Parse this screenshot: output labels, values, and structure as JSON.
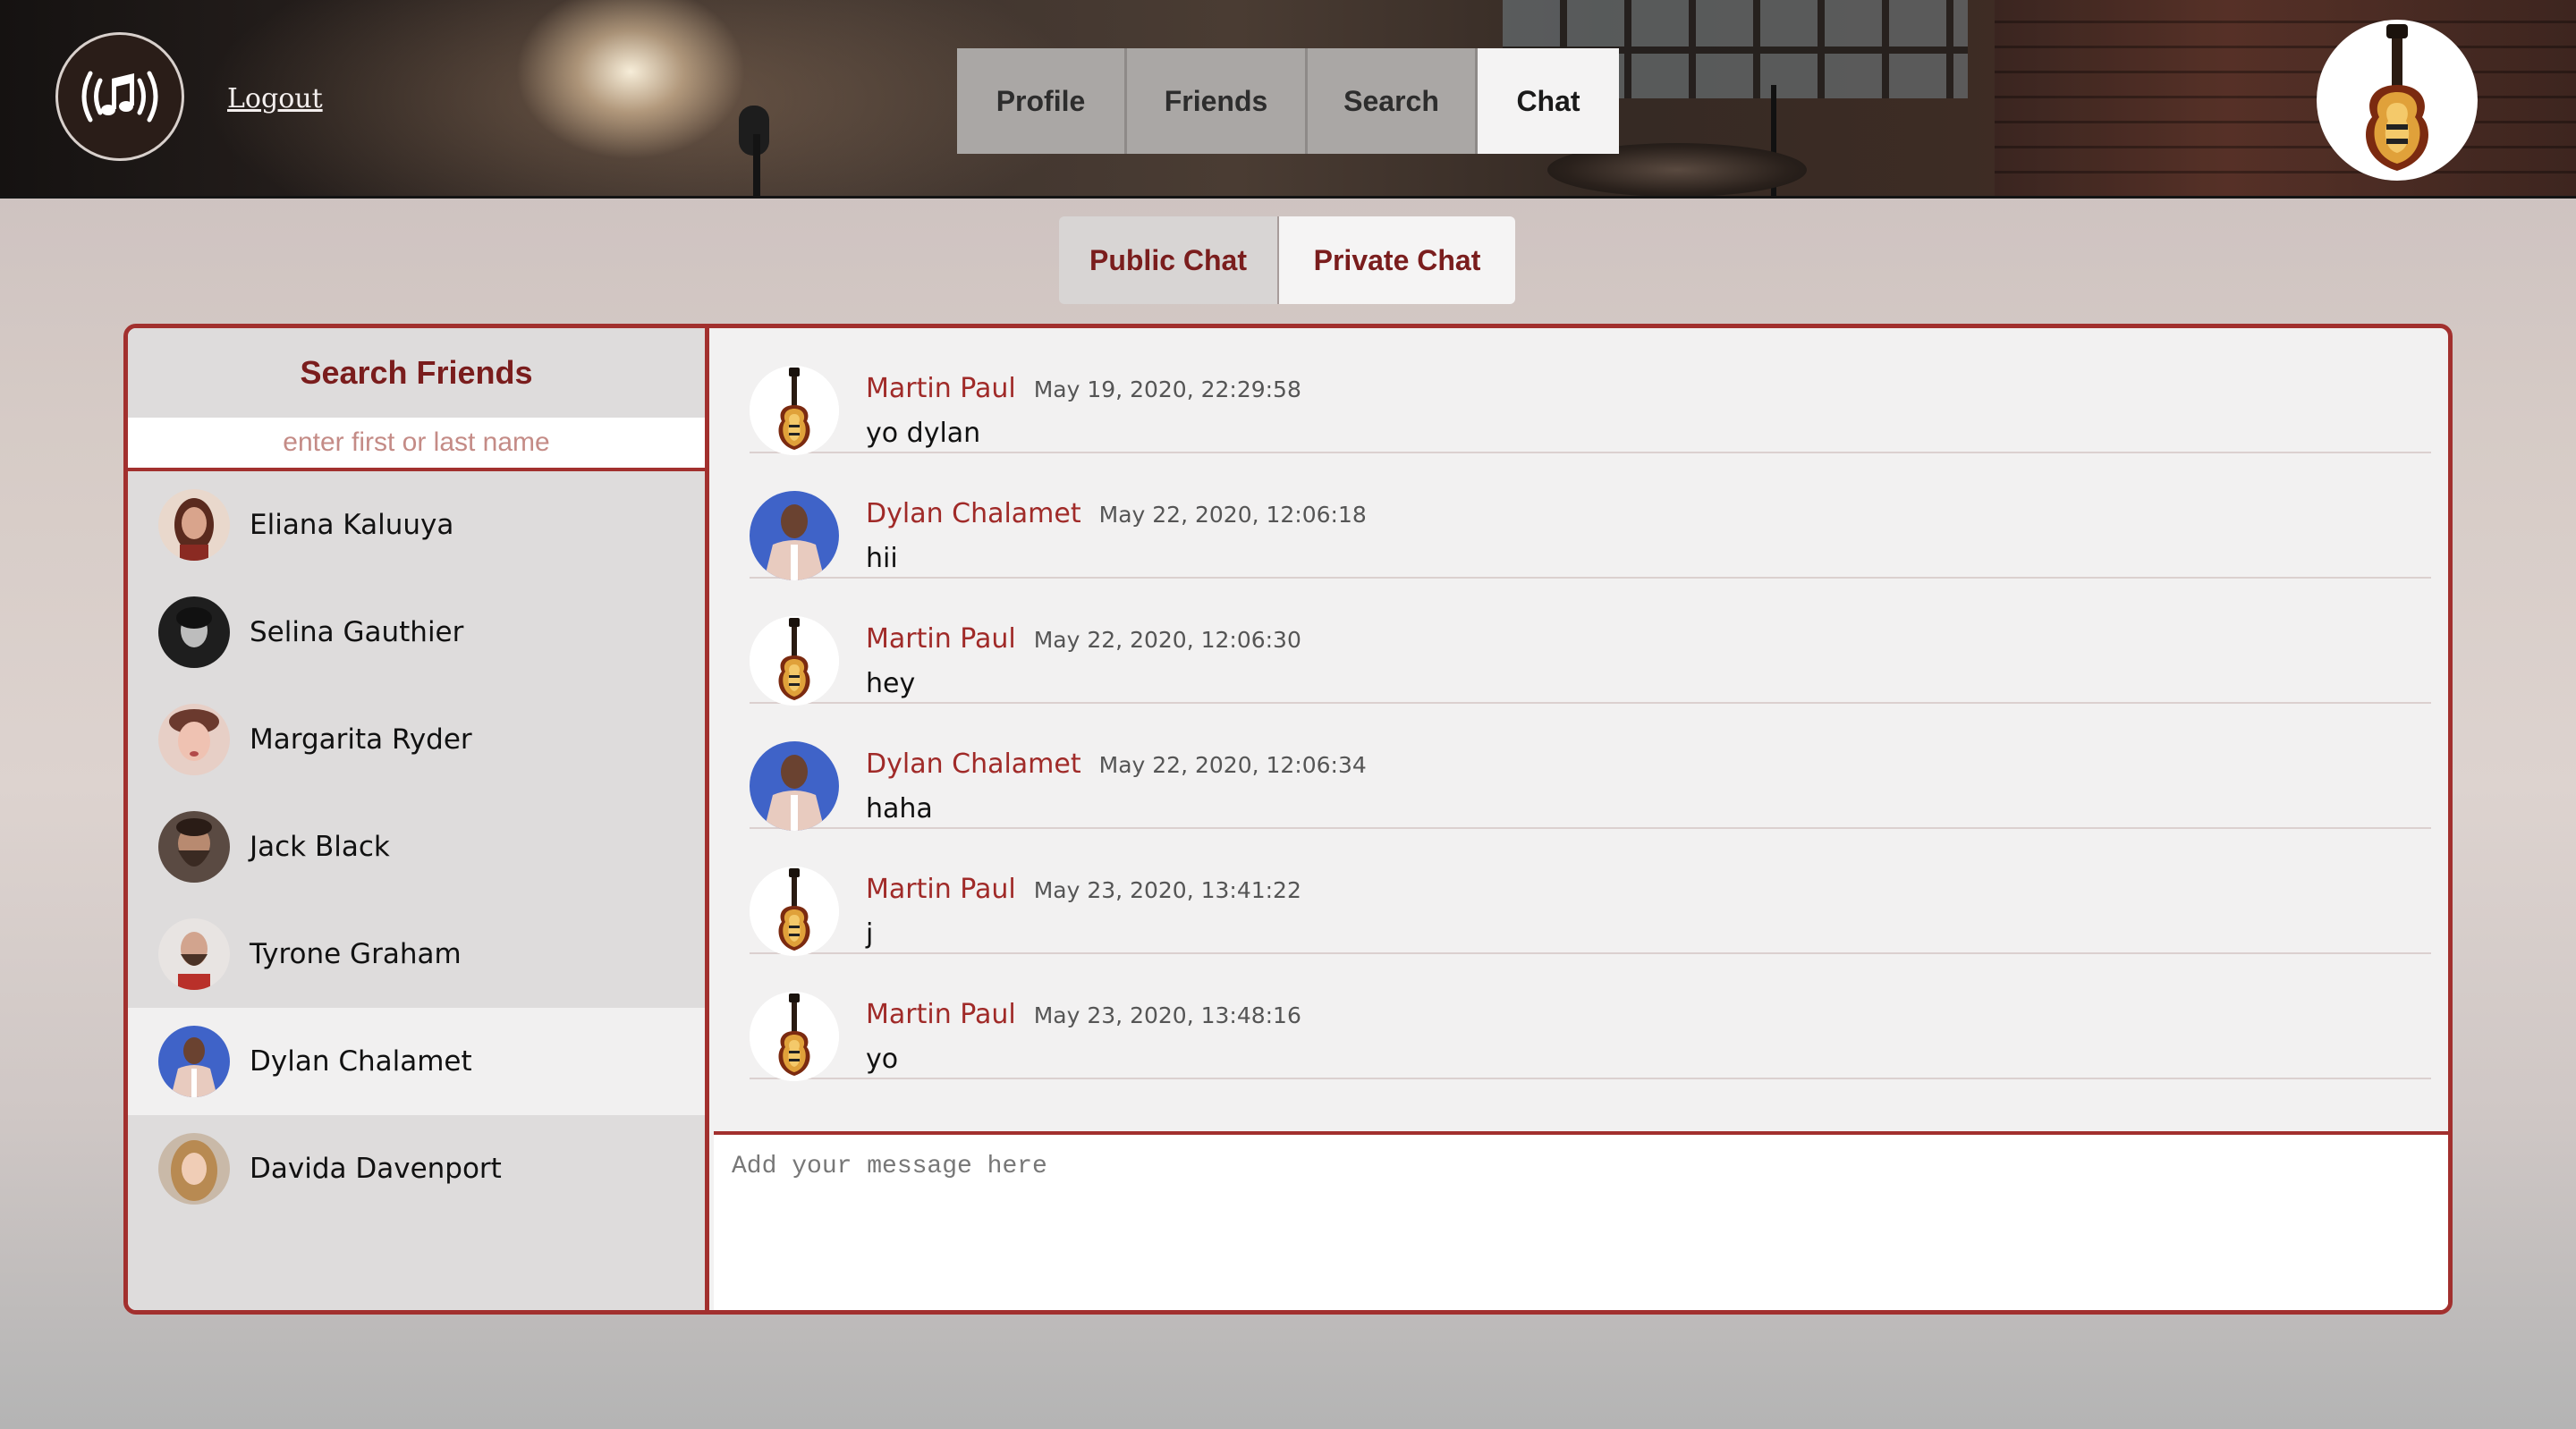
{
  "header": {
    "logout_label": "Logout",
    "nav": [
      {
        "label": "Profile",
        "active": false
      },
      {
        "label": "Friends",
        "active": false
      },
      {
        "label": "Search",
        "active": false
      },
      {
        "label": "Chat",
        "active": true
      }
    ]
  },
  "chat_tabs": [
    {
      "label": "Public Chat",
      "active": false
    },
    {
      "label": "Private Chat",
      "active": true
    }
  ],
  "sidebar": {
    "title": "Search Friends",
    "search_placeholder": "enter first or last name",
    "friends": [
      {
        "name": "Eliana Kaluuya",
        "selected": false
      },
      {
        "name": "Selina Gauthier",
        "selected": false
      },
      {
        "name": "Margarita Ryder",
        "selected": false
      },
      {
        "name": "Jack Black",
        "selected": false
      },
      {
        "name": "Tyrone Graham",
        "selected": false
      },
      {
        "name": "Dylan Chalamet",
        "selected": true
      },
      {
        "name": "Davida Davenport",
        "selected": false
      }
    ]
  },
  "messages": [
    {
      "author": "Martin Paul",
      "time": "May 19, 2020, 22:29:58",
      "text": "yo dylan",
      "avatar": "guitar"
    },
    {
      "author": "Dylan Chalamet",
      "time": "May 22, 2020, 12:06:18",
      "text": "hii",
      "avatar": "person"
    },
    {
      "author": "Martin Paul",
      "time": "May 22, 2020, 12:06:30",
      "text": "hey",
      "avatar": "guitar"
    },
    {
      "author": "Dylan Chalamet",
      "time": "May 22, 2020, 12:06:34",
      "text": "haha",
      "avatar": "person"
    },
    {
      "author": "Martin Paul",
      "time": "May 23, 2020, 13:41:22",
      "text": "j",
      "avatar": "guitar"
    },
    {
      "author": "Martin Paul",
      "time": "May 23, 2020, 13:48:16",
      "text": "yo",
      "avatar": "guitar"
    }
  ],
  "composer": {
    "placeholder": "Add your message here",
    "value": ""
  },
  "colors": {
    "accent": "#a2302e",
    "title": "#7a1d1d",
    "author": "#a02a28"
  }
}
